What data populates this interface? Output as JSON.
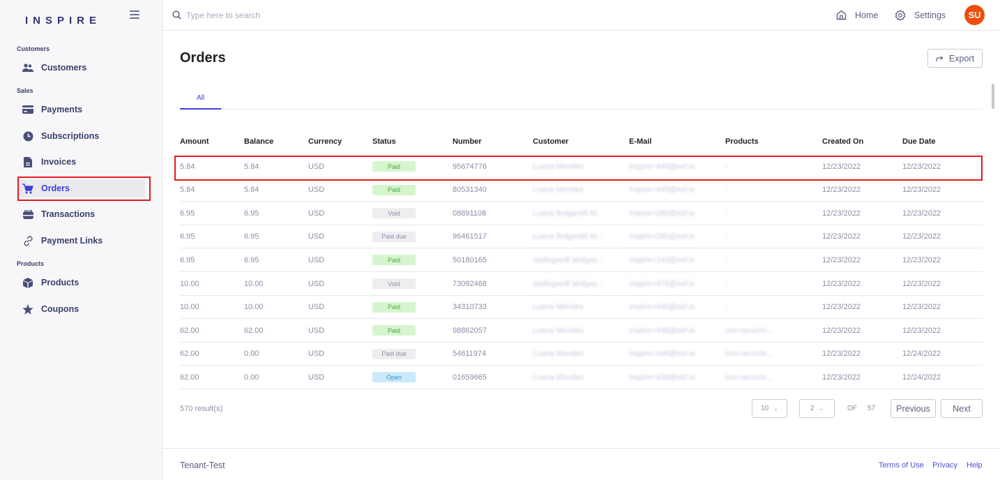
{
  "brand": {
    "logo": "INSPIRE"
  },
  "sidebar": {
    "sections": [
      {
        "label": "Customers"
      },
      {
        "label": "Sales"
      },
      {
        "label": "Products"
      }
    ],
    "items": [
      {
        "label": "Customers",
        "icon": "users-icon"
      },
      {
        "label": "Payments",
        "icon": "credit-card-icon"
      },
      {
        "label": "Subscriptions",
        "icon": "clock-icon"
      },
      {
        "label": "Invoices",
        "icon": "document-icon"
      },
      {
        "label": "Orders",
        "icon": "cart-icon",
        "active": true
      },
      {
        "label": "Transactions",
        "icon": "wallet-icon"
      },
      {
        "label": "Payment Links",
        "icon": "link-icon"
      },
      {
        "label": "Products",
        "icon": "box-icon"
      },
      {
        "label": "Coupons",
        "icon": "star-icon"
      }
    ]
  },
  "header": {
    "search_placeholder": "Type here to search",
    "home_label": "Home",
    "settings_label": "Settings",
    "avatar_initials": "SU"
  },
  "page": {
    "title": "Orders",
    "export_label": "Export",
    "tabs": [
      {
        "label": "All"
      }
    ]
  },
  "table": {
    "columns": [
      "Amount",
      "Balance",
      "Currency",
      "Status",
      "Number",
      "Customer",
      "E-Mail",
      "Products",
      "Created On",
      "Due Date"
    ],
    "rows": [
      {
        "amount": "5.84",
        "balance": "5.84",
        "currency": "USD",
        "status": "Paid",
        "number": "95674776",
        "customer": "Luana Mendes",
        "email": "inspire+445@sof.io",
        "products": "-",
        "created": "12/23/2022",
        "due": "12/23/2022"
      },
      {
        "amount": "5.84",
        "balance": "5.84",
        "currency": "USD",
        "status": "Paid",
        "number": "80531340",
        "customer": "Luana Mendes",
        "email": "inspire+445@sof.io",
        "products": "-",
        "created": "12/23/2022",
        "due": "12/23/2022"
      },
      {
        "amount": "6.95",
        "balance": "6.95",
        "currency": "USD",
        "status": "Void",
        "number": "08891108",
        "customer": "Luana Bulgarelli M...",
        "email": "inspire+280@sof.io",
        "products": "-",
        "created": "12/23/2022",
        "due": "12/23/2022"
      },
      {
        "amount": "6.95",
        "balance": "6.95",
        "currency": "USD",
        "status": "Past due",
        "number": "96461517",
        "customer": "Luana Bulgarelli M...",
        "email": "inspire+280@sof.io",
        "products": "-",
        "created": "12/23/2022",
        "due": "12/23/2022"
      },
      {
        "amount": "6.95",
        "balance": "6.95",
        "currency": "USD",
        "status": "Paid",
        "number": "50180165",
        "customer": "asdfsgasdf atsfgas...",
        "email": "inspire+243@sof.io",
        "products": "-",
        "created": "12/23/2022",
        "due": "12/23/2022"
      },
      {
        "amount": "10.00",
        "balance": "10.00",
        "currency": "USD",
        "status": "Void",
        "number": "73092468",
        "customer": "asdfsgasdf atsfgas...",
        "email": "inspire+478@sof.io",
        "products": "-",
        "created": "12/23/2022",
        "due": "12/23/2022"
      },
      {
        "amount": "10.00",
        "balance": "10.00",
        "currency": "USD",
        "status": "Paid",
        "number": "34310733",
        "customer": "Luana Mendes",
        "email": "inspire+445@sof.io",
        "products": "-",
        "created": "12/23/2022",
        "due": "12/23/2022"
      },
      {
        "amount": "62.00",
        "balance": "62.00",
        "currency": "USD",
        "status": "Paid",
        "number": "98862057",
        "customer": "Luana Mendes",
        "email": "inspire+438@sof.io",
        "products": "non-recurrin...",
        "created": "12/23/2022",
        "due": "12/23/2022"
      },
      {
        "amount": "62.00",
        "balance": "0.00",
        "currency": "USD",
        "status": "Past due",
        "number": "54611974",
        "customer": "Luana Mendes",
        "email": "inspire+446@sof.io",
        "products": "non-recurrin...",
        "created": "12/23/2022",
        "due": "12/24/2022"
      },
      {
        "amount": "62.00",
        "balance": "0.00",
        "currency": "USD",
        "status": "Open",
        "number": "01659665",
        "customer": "Luana Mendes",
        "email": "inspire+438@sof.io",
        "products": "non-recurrin...",
        "created": "12/23/2022",
        "due": "12/24/2022"
      }
    ]
  },
  "status_colors": {
    "Paid": {
      "bg": "#d6f5cf",
      "fg": "#4aa63a"
    },
    "Void": {
      "bg": "#eeeef1",
      "fg": "#8a8da6"
    },
    "Past due": {
      "bg": "#eeeef1",
      "fg": "#8a8da6"
    },
    "Open": {
      "bg": "#c9eafb",
      "fg": "#3b8fd0"
    }
  },
  "pagination": {
    "results_label": "570 result(s)",
    "page_size": "10",
    "current_page": "2",
    "of_label": "OF",
    "total_pages": "57",
    "previous_label": "Previous",
    "next_label": "Next"
  },
  "footer": {
    "tenant": "Tenant-Test",
    "terms": "Terms of Use",
    "privacy": "Privacy",
    "help": "Help"
  },
  "colors": {
    "accent": "#3b3fd8",
    "highlight": "#e01b1b",
    "avatar": "#ef4c0d"
  }
}
